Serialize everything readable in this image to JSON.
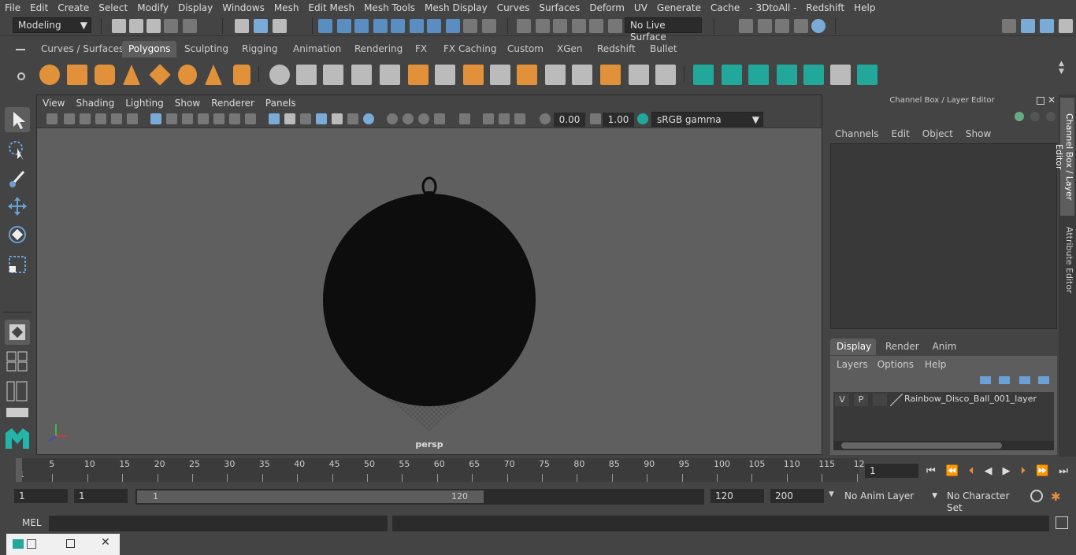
{
  "menu": [
    "File",
    "Edit",
    "Create",
    "Select",
    "Modify",
    "Display",
    "Windows",
    "Mesh",
    "Edit Mesh",
    "Mesh Tools",
    "Mesh Display",
    "Curves",
    "Surfaces",
    "Deform",
    "UV",
    "Generate",
    "Cache",
    "- 3DtoAll -",
    "Redshift",
    "Help"
  ],
  "status": {
    "mode": "Modeling",
    "live_surface": "No Live Surface"
  },
  "shelf_tabs": [
    "Curves / Surfaces",
    "Polygons",
    "Sculpting",
    "Rigging",
    "Animation",
    "Rendering",
    "FX",
    "FX Caching",
    "Custom",
    "XGen",
    "Redshift",
    "Bullet"
  ],
  "shelf_active": "Polygons",
  "viewport": {
    "menu": [
      "View",
      "Shading",
      "Lighting",
      "Show",
      "Renderer",
      "Panels"
    ],
    "exposure": "0.00",
    "gamma": "1.00",
    "colorspace": "sRGB gamma",
    "camera_label": "persp"
  },
  "channel_box": {
    "title": "Channel Box / Layer Editor",
    "menu": [
      "Channels",
      "Edit",
      "Object",
      "Show"
    ],
    "layer_tabs": [
      "Display",
      "Render",
      "Anim"
    ],
    "active_layer_tab": "Display",
    "layer_menu": [
      "Layers",
      "Options",
      "Help"
    ],
    "layer": {
      "v": "V",
      "p": "P",
      "name": "Rainbow_Disco_Ball_001_layer"
    }
  },
  "side_tabs": [
    "Channel Box / Layer Editor",
    "Attribute Editor"
  ],
  "timeline": {
    "ticks": [
      "1",
      "5",
      "10",
      "15",
      "20",
      "25",
      "30",
      "35",
      "40",
      "45",
      "50",
      "55",
      "60",
      "65",
      "70",
      "75",
      "80",
      "85",
      "90",
      "95",
      "100",
      "105",
      "110",
      "115",
      "12"
    ],
    "current_frame": "1"
  },
  "range": {
    "start": "1",
    "playback_start": "1",
    "slider_start": "1",
    "slider_end": "120",
    "playback_end": "120",
    "end": "200",
    "anim_layer": "No Anim Layer",
    "character_set": "No Character Set"
  },
  "command_line": {
    "label": "MEL"
  }
}
